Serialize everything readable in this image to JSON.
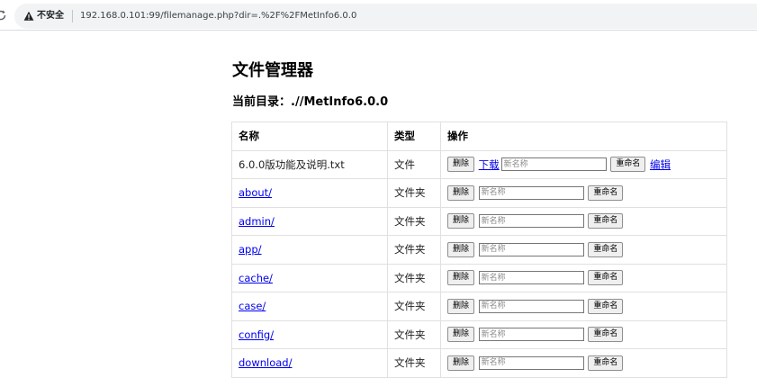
{
  "browser": {
    "insecure_label": "不安全",
    "url": "192.168.0.101:99/filemanage.php?dir=.%2F%2FMetInfo6.0.0"
  },
  "page": {
    "title": "文件管理器",
    "current_dir_label": "当前目录：",
    "current_dir_value": ".//MetInfo6.0.0"
  },
  "table": {
    "headers": {
      "name": "名称",
      "type": "类型",
      "ops": "操作"
    },
    "rows": [
      {
        "name": "6.0.0版功能及说明.txt",
        "type": "文件",
        "is_link": false
      },
      {
        "name": "about/",
        "type": "文件夹",
        "is_link": true
      },
      {
        "name": "admin/",
        "type": "文件夹",
        "is_link": true
      },
      {
        "name": "app/",
        "type": "文件夹",
        "is_link": true
      },
      {
        "name": "cache/",
        "type": "文件夹",
        "is_link": true
      },
      {
        "name": "case/",
        "type": "文件夹",
        "is_link": true
      },
      {
        "name": "config/",
        "type": "文件夹",
        "is_link": true
      },
      {
        "name": "download/",
        "type": "文件夹",
        "is_link": true
      }
    ],
    "actions": {
      "delete": "删除",
      "download": "下载",
      "rename": "重命名",
      "edit": "编辑",
      "new_name_placeholder": "新名称"
    }
  }
}
